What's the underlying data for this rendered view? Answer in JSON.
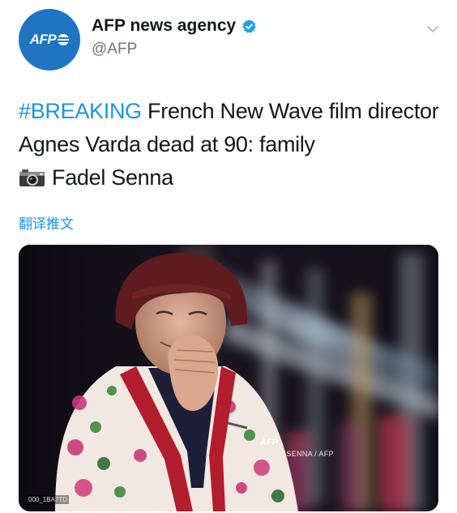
{
  "author": {
    "display_name": "AFP news agency",
    "handle": "@AFP",
    "avatar_text": "AFP",
    "verified": true,
    "brand_color": "#1f75c2"
  },
  "tweet": {
    "hashtag": "#BREAKING",
    "text_after_hashtag": " French New Wave film director Agnes Varda dead at 90: family",
    "camera_icon": "camera-emoji-icon",
    "photo_credit_name": "Fadel Senna",
    "translate_label": "翻译推文",
    "hashtag_color": "#1b95e0"
  },
  "photo": {
    "watermark_logo": "AFP",
    "credit": "FADEL SENNA / AFP",
    "image_id": "000_1BA7TD"
  }
}
